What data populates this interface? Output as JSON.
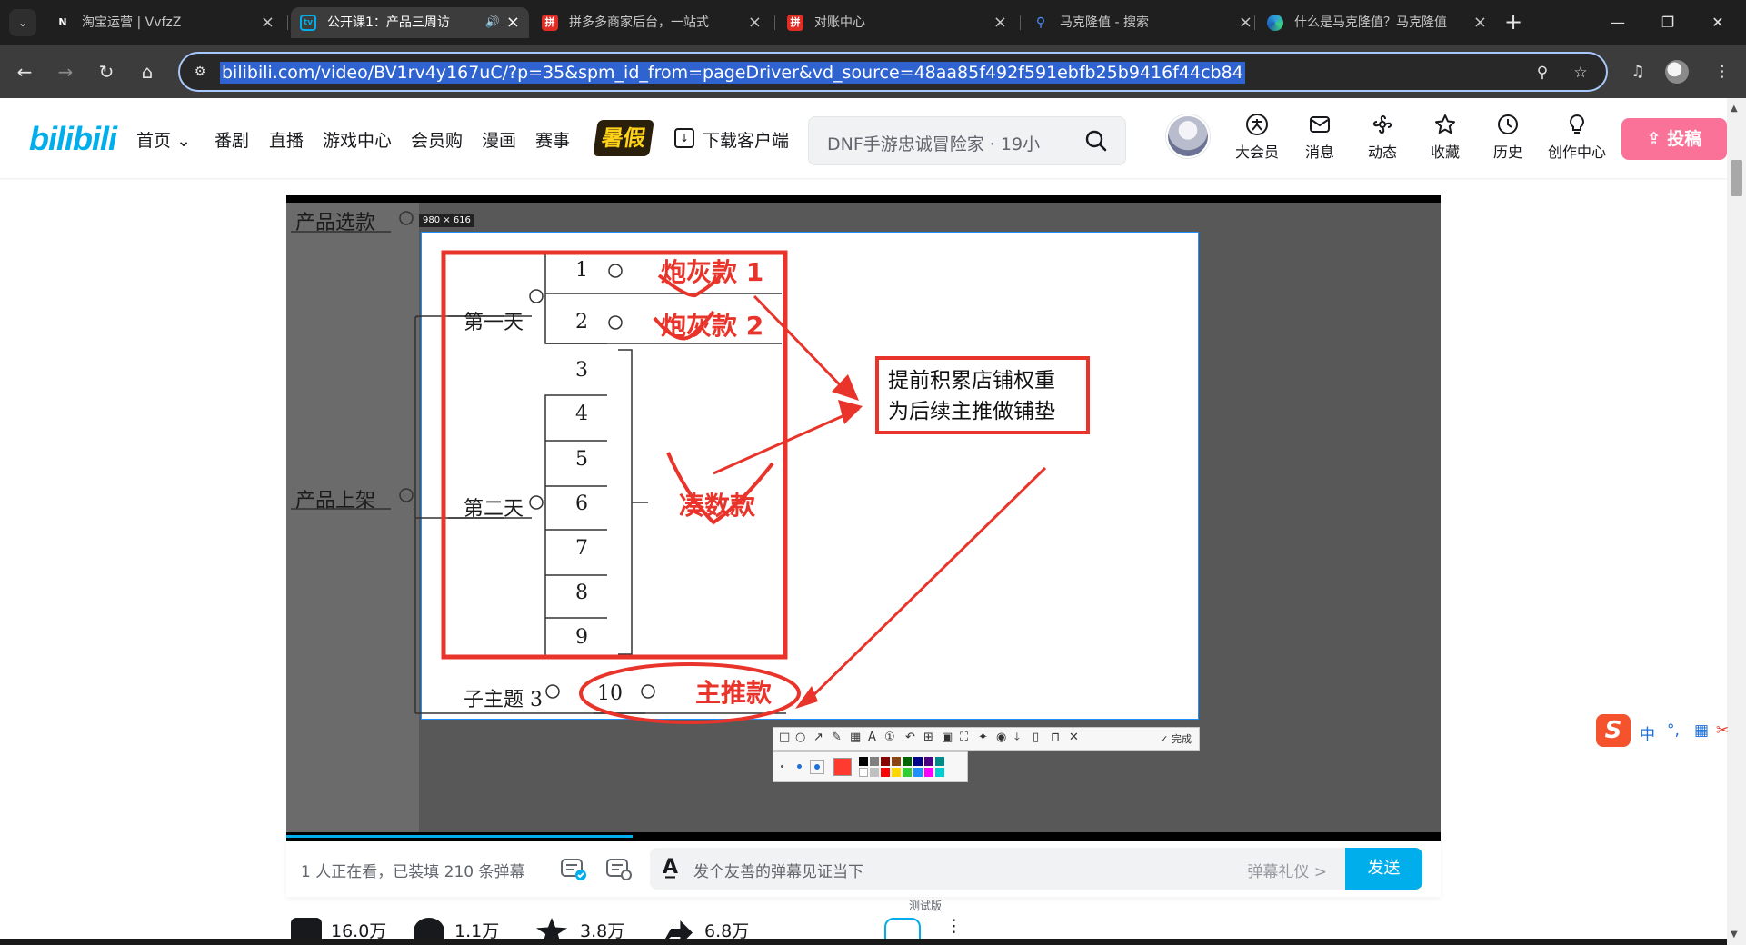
{
  "browser": {
    "tabs": [
      {
        "title": "淘宝运营 | VvfzZ",
        "favicon": "N",
        "favicon_color": "#000000",
        "active": false
      },
      {
        "title": "公开课1：产品三周访",
        "favicon": "tv",
        "favicon_color": "#00aeec",
        "active": true,
        "audio": true
      },
      {
        "title": "拼多多商家后台，一站式",
        "favicon": "拼",
        "favicon_color": "#e02e24",
        "active": false
      },
      {
        "title": "对账中心",
        "favicon": "拼",
        "favicon_color": "#e02e24",
        "active": false
      },
      {
        "title": "马克隆值 - 搜索",
        "favicon": "search-icon",
        "favicon_color": "#4c8df6",
        "active": false
      },
      {
        "title": "什么是马克隆值？马克隆值",
        "favicon": "edge-icon",
        "favicon_color": "#2d9cdb",
        "active": false
      }
    ],
    "new_tab": "+",
    "window_buttons": {
      "minimize": "—",
      "restore": "❐",
      "close": "✕"
    },
    "url": "bilibili.com/video/BV1rv4y167uC/?p=35&spm_id_from=pageDriver&vd_source=48aa85f492f591ebfb25b9416f44cb84"
  },
  "header": {
    "logo": "bilibili",
    "nav": [
      "首页",
      "番剧",
      "直播",
      "游戏中心",
      "会员购",
      "漫画",
      "赛事"
    ],
    "badge": "暑假",
    "download": "下载客户端",
    "search_placeholder": "DNF手游忠诚冒险家 · 19小",
    "icons": [
      {
        "name": "big-member",
        "label": "大会员"
      },
      {
        "name": "message",
        "label": "消息"
      },
      {
        "name": "dynamic",
        "label": "动态"
      },
      {
        "name": "favorite",
        "label": "收藏"
      },
      {
        "name": "history",
        "label": "历史"
      },
      {
        "name": "creation",
        "label": "创作中心"
      }
    ],
    "upload": "投稿"
  },
  "video": {
    "size_tag": "980 × 616",
    "side_nodes": [
      "产品选款",
      "产品上架"
    ],
    "mindmap": {
      "day1": "第一天",
      "day2": "第二天",
      "subtopic": "子主题 3",
      "numbers": [
        "1",
        "2",
        "3",
        "4",
        "5",
        "6",
        "7",
        "8",
        "9",
        "10"
      ]
    },
    "annotations": [
      "炮灰款 1",
      "炮灰款 2",
      "凑数款",
      "主推款"
    ],
    "callout": [
      "提前积累店铺权重",
      "为后续主推做铺垫"
    ],
    "snip_done": "完成",
    "progress_fraction": 0.3
  },
  "danmaku": {
    "info": "1 人正在看，已装填 210 条弹幕",
    "placeholder": "发个友善的弹幕见证当下",
    "etiquette": "弹幕礼仪 >",
    "send": "发送"
  },
  "below": {
    "test_tag": "测试版",
    "stats": [
      "16.0万",
      "1.1万",
      "3.8万",
      "6.8万"
    ]
  },
  "ime": {
    "items": [
      "中",
      "°,",
      "▦",
      "✂"
    ]
  }
}
